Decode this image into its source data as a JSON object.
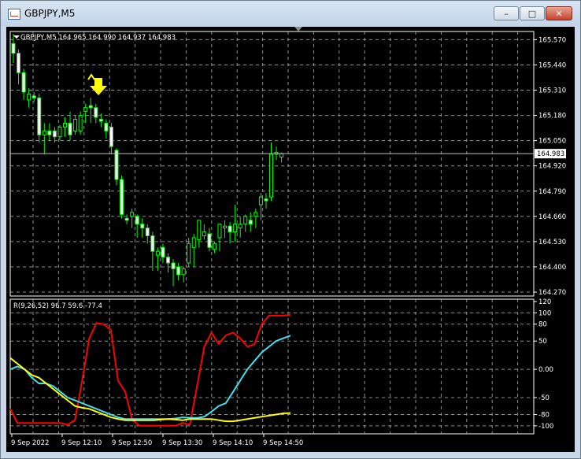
{
  "window": {
    "title": "GBPJPY,M5",
    "minimize_glyph": "–",
    "maximize_glyph": "□",
    "close_glyph": "✕"
  },
  "chart": {
    "header": "GBPJPY,M5  164.965 164.990 164.937 164.983",
    "current_price": "164.983",
    "price_ticks": [
      "165.570",
      "165.440",
      "165.310",
      "165.180",
      "165.050",
      "164.920",
      "164.790",
      "164.660",
      "164.530",
      "164.400",
      "164.270"
    ],
    "time_labels": [
      "9 Sep 2022",
      "9 Sep 12:10",
      "9 Sep 12:50",
      "9 Sep 13:30",
      "9 Sep 14:10",
      "9 Sep 14:50"
    ],
    "indicator_header": "R(9,26,52) 96.7 59.6 -77.4",
    "indicator_ticks": [
      "120",
      "100",
      "80",
      "50",
      "0.00",
      "-50",
      "-80",
      "-100"
    ],
    "colors": {
      "bg": "#000000",
      "up": "#00ff00",
      "candle_fill": "#ffffff",
      "line_red": "#ff0000",
      "line_cyan": "#40e0f0",
      "line_yellow": "#ffff00",
      "grid": "#c0c0c0",
      "arrow": "#ffff00"
    },
    "arrow_icon": "yellow-down-arrow-icon"
  },
  "chart_data": [
    {
      "type": "candlestick",
      "title": "GBPJPY,M5",
      "ylim": [
        164.27,
        165.6
      ],
      "ohlc": [
        [
          165.55,
          165.6,
          165.45,
          165.5
        ],
        [
          165.5,
          165.52,
          165.34,
          165.4
        ],
        [
          165.4,
          165.42,
          165.26,
          165.3
        ],
        [
          165.26,
          165.32,
          165.22,
          165.29
        ],
        [
          165.28,
          165.3,
          165.25,
          165.27
        ],
        [
          165.27,
          165.29,
          165.04,
          165.08
        ],
        [
          165.08,
          165.14,
          164.98,
          165.1
        ],
        [
          165.1,
          165.14,
          165.05,
          165.08
        ],
        [
          165.1,
          165.12,
          165.04,
          165.07
        ],
        [
          165.07,
          165.13,
          165.05,
          165.12
        ],
        [
          165.12,
          165.17,
          165.07,
          165.14
        ],
        [
          165.14,
          165.2,
          165.05,
          165.08
        ],
        [
          165.1,
          165.18,
          165.08,
          165.16
        ],
        [
          165.1,
          165.2,
          165.08,
          165.18
        ],
        [
          165.2,
          165.24,
          165.14,
          165.22
        ],
        [
          165.23,
          165.27,
          165.14,
          165.22
        ],
        [
          165.22,
          165.24,
          165.14,
          165.17
        ],
        [
          165.16,
          165.19,
          165.12,
          165.15
        ],
        [
          165.14,
          165.16,
          165.06,
          165.1
        ],
        [
          165.12,
          165.14,
          164.98,
          165.02
        ],
        [
          165.0,
          165.01,
          164.82,
          164.85
        ],
        [
          164.85,
          164.87,
          164.65,
          164.67
        ],
        [
          164.65,
          164.67,
          164.62,
          164.64
        ],
        [
          164.66,
          164.7,
          164.6,
          164.68
        ],
        [
          164.66,
          164.67,
          164.55,
          164.62
        ],
        [
          164.62,
          164.65,
          164.55,
          164.6
        ],
        [
          164.6,
          164.62,
          164.52,
          164.56
        ],
        [
          164.56,
          164.58,
          164.38,
          164.48
        ],
        [
          164.46,
          164.5,
          164.38,
          164.48
        ],
        [
          164.5,
          164.52,
          164.42,
          164.45
        ],
        [
          164.45,
          164.47,
          164.37,
          164.42
        ],
        [
          164.42,
          164.44,
          164.3,
          164.39
        ],
        [
          164.4,
          164.42,
          164.33,
          164.36
        ],
        [
          164.36,
          164.4,
          164.32,
          164.39
        ],
        [
          164.42,
          164.55,
          164.4,
          164.52
        ],
        [
          164.5,
          164.57,
          164.4,
          164.55
        ],
        [
          164.54,
          164.6,
          164.5,
          164.64
        ],
        [
          164.56,
          164.62,
          164.54,
          164.58
        ],
        [
          164.57,
          164.6,
          164.48,
          164.5
        ],
        [
          164.49,
          164.53,
          164.47,
          164.52
        ],
        [
          164.55,
          164.6,
          164.48,
          164.62
        ],
        [
          164.6,
          164.64,
          164.55,
          164.61
        ],
        [
          164.61,
          164.63,
          164.52,
          164.58
        ],
        [
          164.58,
          164.72,
          164.53,
          164.62
        ],
        [
          164.6,
          164.66,
          164.55,
          164.62
        ],
        [
          164.62,
          164.67,
          164.58,
          164.66
        ],
        [
          164.64,
          164.68,
          164.58,
          164.62
        ],
        [
          164.66,
          164.7,
          164.6,
          164.68
        ],
        [
          164.72,
          164.78,
          164.64,
          164.76
        ],
        [
          164.75,
          164.78,
          164.7,
          164.74
        ],
        [
          164.76,
          165.04,
          164.74,
          164.98
        ],
        [
          164.98,
          165.02,
          164.95,
          164.99
        ],
        [
          164.965,
          164.99,
          164.937,
          164.983
        ]
      ]
    },
    {
      "type": "line",
      "title": "R(9,26,52)",
      "ylim": [
        -110,
        120
      ],
      "series": [
        {
          "name": "9",
          "color": "#ff0000",
          "values": [
            -70,
            -95,
            -95,
            -95,
            -95,
            -95,
            -95,
            -95,
            -98,
            -90,
            -20,
            55,
            82,
            80,
            70,
            -20,
            -40,
            -90,
            -100,
            -100,
            -100,
            -100,
            -100,
            -100,
            -95,
            -98,
            -30,
            40,
            65,
            45,
            60,
            65,
            55,
            40,
            45,
            80,
            95,
            95,
            95,
            96.7
          ]
        },
        {
          "name": "26",
          "color": "#40e0f0",
          "values": [
            0,
            5,
            0,
            -15,
            -25,
            -25,
            -30,
            -40,
            -50,
            -55,
            -60,
            -65,
            -70,
            -75,
            -80,
            -85,
            -88,
            -88,
            -88,
            -88,
            -88,
            -88,
            -88,
            -87,
            -85,
            -86,
            -86,
            -84,
            -75,
            -65,
            -60,
            -40,
            -20,
            0,
            15,
            30,
            40,
            50,
            55,
            59.6
          ]
        },
        {
          "name": "52",
          "color": "#ffff00",
          "values": [
            20,
            10,
            0,
            -10,
            -15,
            -25,
            -35,
            -45,
            -55,
            -65,
            -68,
            -70,
            -75,
            -80,
            -85,
            -88,
            -90,
            -90,
            -90,
            -90,
            -90,
            -89,
            -88,
            -89,
            -90,
            -88,
            -88,
            -88,
            -88,
            -90,
            -92,
            -92,
            -90,
            -88,
            -86,
            -84,
            -82,
            -80,
            -78,
            -77.4
          ]
        }
      ]
    }
  ]
}
